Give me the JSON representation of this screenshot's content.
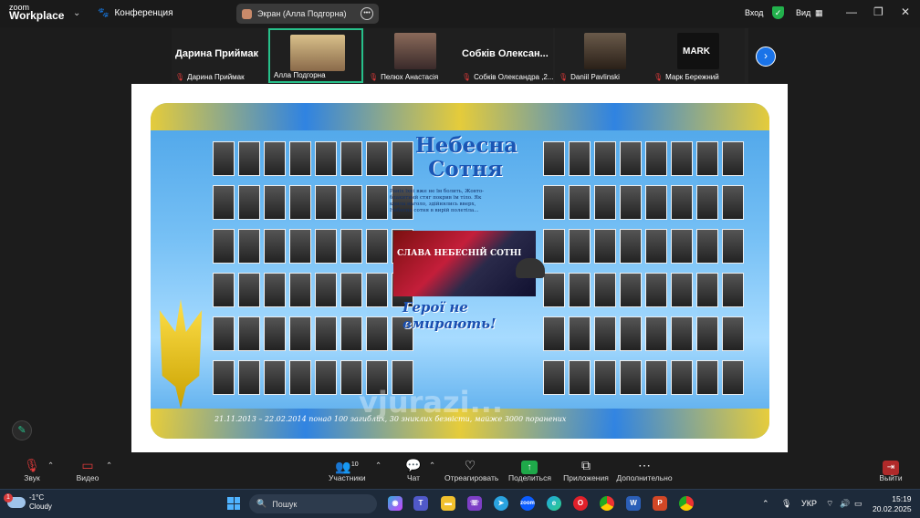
{
  "titlebar": {
    "logo_small": "zoom",
    "logo_big": "Workplace",
    "conference_label": "Конференция",
    "share_pill_label": "Экран (Алла Подгорна)",
    "login_label": "Вход",
    "view_label": "Вид"
  },
  "participants": [
    {
      "big_name": "Дарина Приймак",
      "label": "Дарина Приймак",
      "video": false,
      "active": false
    },
    {
      "big_name": "",
      "label": "Алла Подгорна",
      "video": true,
      "active": true
    },
    {
      "big_name": "",
      "label": "Пелюх Анастасія",
      "video": true,
      "active": false
    },
    {
      "big_name": "Собків Олексан...",
      "label": "Собків Олександра ,2...",
      "video": false,
      "active": false
    },
    {
      "big_name": "",
      "label": "Daniil Pavlinski",
      "video": true,
      "active": false
    },
    {
      "big_name": "MARK",
      "label": "Марк Бережний",
      "video": false,
      "active": false
    }
  ],
  "poster": {
    "title_line1": "Небесна",
    "title_line2": "Сотня",
    "poem": "Раніх їхні вже не їм болить, Жовто-блакитний стяг покрив їм тіло. Як крила наголо, здійнялись вверх, Небесна сотня в вирій полетіла...",
    "collage_text": "СЛАВА НЕБЕСНІЙ СОТНІ",
    "heroes": "Герої не вмирають!",
    "caption": "21.11.2013 – 22.02.2014 понад 100 загиблих, 30 зниклих безвісти, майже 3000 поранених",
    "watermark": "vjurazi..."
  },
  "toolbar": {
    "sound": "Звук",
    "video": "Видео",
    "participants": "Участники",
    "participants_count": "10",
    "chat": "Чат",
    "react": "Отреагировать",
    "share": "Поделиться",
    "apps": "Приложения",
    "more": "Дополнительно",
    "leave": "Выйти"
  },
  "taskbar": {
    "weather_badge": "1",
    "temperature": "-1°C",
    "weather": "Cloudy",
    "search_placeholder": "Пошук",
    "language": "УКР",
    "time": "15:19",
    "date": "20.02.2025"
  },
  "colors": {
    "accent_green": "#27c08a",
    "share_green": "#1fa94a",
    "mic_off_red": "#e03a3a"
  }
}
